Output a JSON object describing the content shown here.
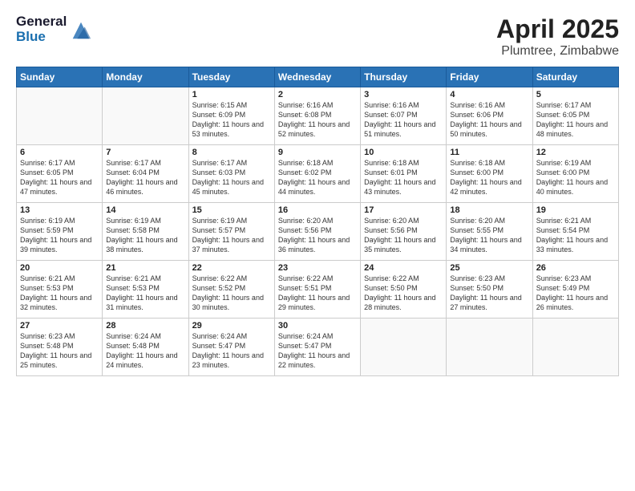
{
  "logo": {
    "general": "General",
    "blue": "Blue"
  },
  "title": "April 2025",
  "subtitle": "Plumtree, Zimbabwe",
  "weekdays": [
    "Sunday",
    "Monday",
    "Tuesday",
    "Wednesday",
    "Thursday",
    "Friday",
    "Saturday"
  ],
  "weeks": [
    [
      {
        "day": "",
        "info": ""
      },
      {
        "day": "",
        "info": ""
      },
      {
        "day": "1",
        "info": "Sunrise: 6:15 AM\nSunset: 6:09 PM\nDaylight: 11 hours and 53 minutes."
      },
      {
        "day": "2",
        "info": "Sunrise: 6:16 AM\nSunset: 6:08 PM\nDaylight: 11 hours and 52 minutes."
      },
      {
        "day": "3",
        "info": "Sunrise: 6:16 AM\nSunset: 6:07 PM\nDaylight: 11 hours and 51 minutes."
      },
      {
        "day": "4",
        "info": "Sunrise: 6:16 AM\nSunset: 6:06 PM\nDaylight: 11 hours and 50 minutes."
      },
      {
        "day": "5",
        "info": "Sunrise: 6:17 AM\nSunset: 6:05 PM\nDaylight: 11 hours and 48 minutes."
      }
    ],
    [
      {
        "day": "6",
        "info": "Sunrise: 6:17 AM\nSunset: 6:05 PM\nDaylight: 11 hours and 47 minutes."
      },
      {
        "day": "7",
        "info": "Sunrise: 6:17 AM\nSunset: 6:04 PM\nDaylight: 11 hours and 46 minutes."
      },
      {
        "day": "8",
        "info": "Sunrise: 6:17 AM\nSunset: 6:03 PM\nDaylight: 11 hours and 45 minutes."
      },
      {
        "day": "9",
        "info": "Sunrise: 6:18 AM\nSunset: 6:02 PM\nDaylight: 11 hours and 44 minutes."
      },
      {
        "day": "10",
        "info": "Sunrise: 6:18 AM\nSunset: 6:01 PM\nDaylight: 11 hours and 43 minutes."
      },
      {
        "day": "11",
        "info": "Sunrise: 6:18 AM\nSunset: 6:00 PM\nDaylight: 11 hours and 42 minutes."
      },
      {
        "day": "12",
        "info": "Sunrise: 6:19 AM\nSunset: 6:00 PM\nDaylight: 11 hours and 40 minutes."
      }
    ],
    [
      {
        "day": "13",
        "info": "Sunrise: 6:19 AM\nSunset: 5:59 PM\nDaylight: 11 hours and 39 minutes."
      },
      {
        "day": "14",
        "info": "Sunrise: 6:19 AM\nSunset: 5:58 PM\nDaylight: 11 hours and 38 minutes."
      },
      {
        "day": "15",
        "info": "Sunrise: 6:19 AM\nSunset: 5:57 PM\nDaylight: 11 hours and 37 minutes."
      },
      {
        "day": "16",
        "info": "Sunrise: 6:20 AM\nSunset: 5:56 PM\nDaylight: 11 hours and 36 minutes."
      },
      {
        "day": "17",
        "info": "Sunrise: 6:20 AM\nSunset: 5:56 PM\nDaylight: 11 hours and 35 minutes."
      },
      {
        "day": "18",
        "info": "Sunrise: 6:20 AM\nSunset: 5:55 PM\nDaylight: 11 hours and 34 minutes."
      },
      {
        "day": "19",
        "info": "Sunrise: 6:21 AM\nSunset: 5:54 PM\nDaylight: 11 hours and 33 minutes."
      }
    ],
    [
      {
        "day": "20",
        "info": "Sunrise: 6:21 AM\nSunset: 5:53 PM\nDaylight: 11 hours and 32 minutes."
      },
      {
        "day": "21",
        "info": "Sunrise: 6:21 AM\nSunset: 5:53 PM\nDaylight: 11 hours and 31 minutes."
      },
      {
        "day": "22",
        "info": "Sunrise: 6:22 AM\nSunset: 5:52 PM\nDaylight: 11 hours and 30 minutes."
      },
      {
        "day": "23",
        "info": "Sunrise: 6:22 AM\nSunset: 5:51 PM\nDaylight: 11 hours and 29 minutes."
      },
      {
        "day": "24",
        "info": "Sunrise: 6:22 AM\nSunset: 5:50 PM\nDaylight: 11 hours and 28 minutes."
      },
      {
        "day": "25",
        "info": "Sunrise: 6:23 AM\nSunset: 5:50 PM\nDaylight: 11 hours and 27 minutes."
      },
      {
        "day": "26",
        "info": "Sunrise: 6:23 AM\nSunset: 5:49 PM\nDaylight: 11 hours and 26 minutes."
      }
    ],
    [
      {
        "day": "27",
        "info": "Sunrise: 6:23 AM\nSunset: 5:48 PM\nDaylight: 11 hours and 25 minutes."
      },
      {
        "day": "28",
        "info": "Sunrise: 6:24 AM\nSunset: 5:48 PM\nDaylight: 11 hours and 24 minutes."
      },
      {
        "day": "29",
        "info": "Sunrise: 6:24 AM\nSunset: 5:47 PM\nDaylight: 11 hours and 23 minutes."
      },
      {
        "day": "30",
        "info": "Sunrise: 6:24 AM\nSunset: 5:47 PM\nDaylight: 11 hours and 22 minutes."
      },
      {
        "day": "",
        "info": ""
      },
      {
        "day": "",
        "info": ""
      },
      {
        "day": "",
        "info": ""
      }
    ]
  ]
}
